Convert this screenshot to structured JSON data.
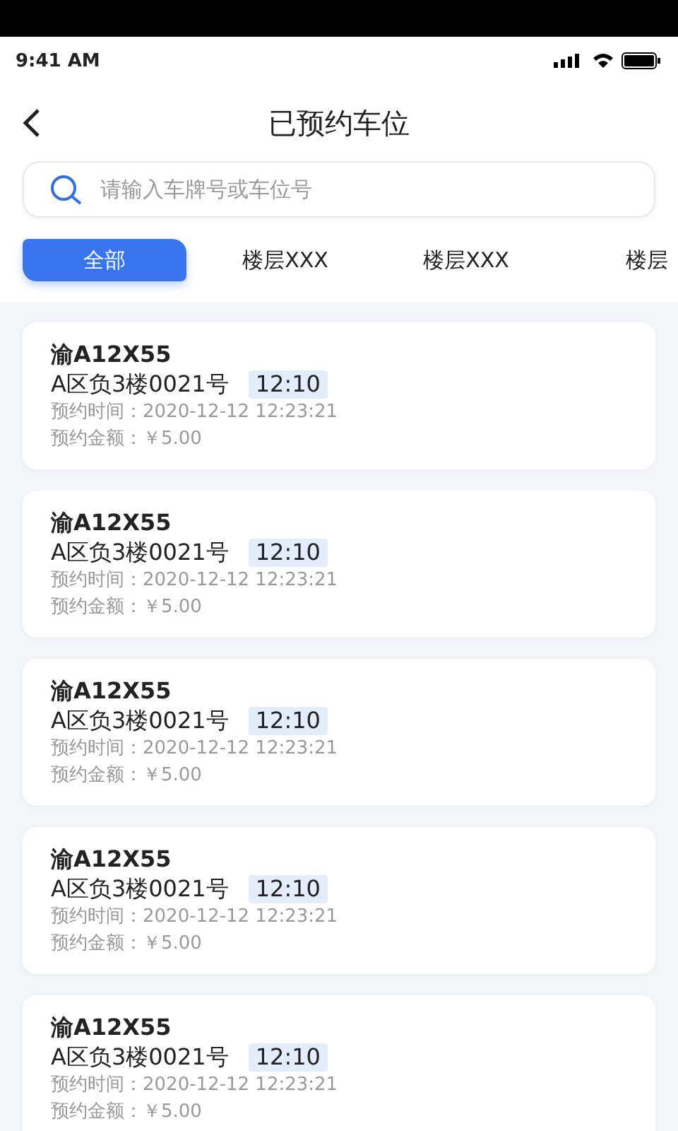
{
  "status_bar": {
    "time": "9:41 AM"
  },
  "header": {
    "title": "已预约车位"
  },
  "search": {
    "placeholder": "请输入车牌号或车位号"
  },
  "tabs": [
    {
      "label": "全部",
      "selected": true
    },
    {
      "label": "楼层XXX",
      "selected": false
    },
    {
      "label": "楼层XXX",
      "selected": false
    },
    {
      "label": "楼层",
      "selected": false
    }
  ],
  "reservations": [
    {
      "plate": "渝A12X55",
      "spot": "A区负3楼0021号",
      "duration": "12:10",
      "time": "预约时间：2020-12-12 12:23:21",
      "amount": "预约金额：￥5.00"
    },
    {
      "plate": "渝A12X55",
      "spot": "A区负3楼0021号",
      "duration": "12:10",
      "time": "预约时间：2020-12-12 12:23:21",
      "amount": "预约金额：￥5.00"
    },
    {
      "plate": "渝A12X55",
      "spot": "A区负3楼0021号",
      "duration": "12:10",
      "time": "预约时间：2020-12-12 12:23:21",
      "amount": "预约金额：￥5.00"
    },
    {
      "plate": "渝A12X55",
      "spot": "A区负3楼0021号",
      "duration": "12:10",
      "time": "预约时间：2020-12-12 12:23:21",
      "amount": "预约金额：￥5.00"
    },
    {
      "plate": "渝A12X55",
      "spot": "A区负3楼0021号",
      "duration": "12:10",
      "time": "预约时间：2020-12-12 12:23:21",
      "amount": "预约金额：￥5.00"
    }
  ]
}
